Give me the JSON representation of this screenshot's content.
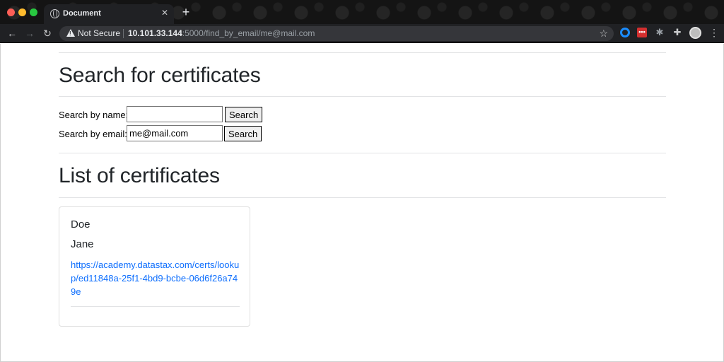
{
  "browser": {
    "tab_title": "Document",
    "tab_close": "✕",
    "new_tab": "+",
    "not_secure": "Not Secure",
    "url_host": "10.101.33.144",
    "url_path": ":5000/find_by_email/me@mail.com"
  },
  "search_section": {
    "heading": "Search for certificates",
    "name_label": "Search by name:",
    "name_value": "",
    "name_button": "Search",
    "email_label": "Search by email:",
    "email_value": "me@mail.com",
    "email_button": "Search"
  },
  "list_section": {
    "heading": "List of certificates",
    "certificates": [
      {
        "last_name": "Doe",
        "first_name": "Jane",
        "link": "https://academy.datastax.com/certs/lookup/ed11848a-25f1-4bd9-bcbe-06d6f26a749e"
      }
    ]
  }
}
